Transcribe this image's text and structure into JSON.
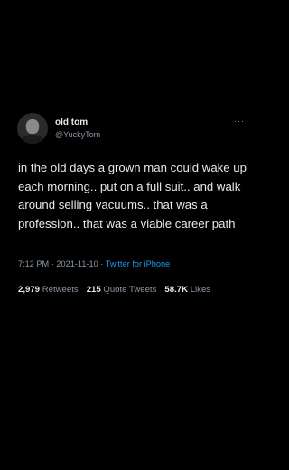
{
  "author": {
    "name": "old tom",
    "handle": "@YuckyTom"
  },
  "menu_glyph": "···",
  "tweet_text": "in the old days a grown man could wake up each morning.. put on a full suit.. and walk around selling vacuums.. that was a profession.. that was a viable career path",
  "meta": {
    "time": "7:12 PM",
    "separator": " · ",
    "date": "2021-11-10",
    "source": "Twitter for iPhone"
  },
  "stats": {
    "retweets_count": "2,979",
    "retweets_label": "Retweets",
    "quotes_count": "215",
    "quotes_label": "Quote Tweets",
    "likes_count": "58.7K",
    "likes_label": "Likes"
  },
  "colors": {
    "background": "#000000",
    "text": "#e7e9ea",
    "muted": "#8b98a5",
    "link": "#1d9bf0"
  }
}
